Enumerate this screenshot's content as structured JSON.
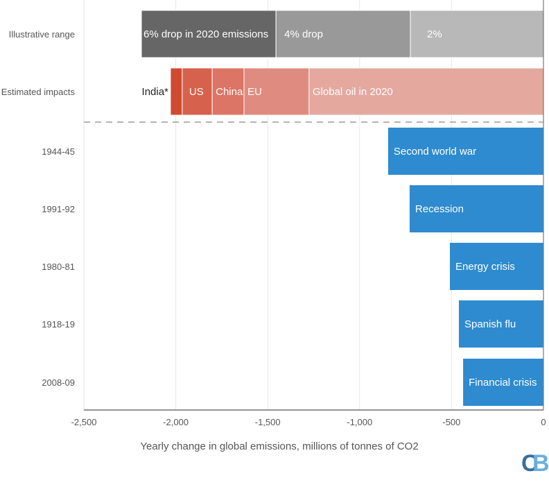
{
  "chart_data": {
    "type": "bar",
    "orientation": "horizontal",
    "title": "",
    "xlabel": "Yearly change in global emissions, millions of tonnes of CO2",
    "ylabel": "",
    "xlim": [
      -2500,
      0
    ],
    "xticks": [
      -2500,
      -2000,
      -1500,
      -1000,
      -500,
      0
    ],
    "xtick_labels": [
      "-2,500",
      "-2,000",
      "-1,500",
      "-1,000",
      "-500",
      "0"
    ],
    "grid": true,
    "rows": [
      {
        "category": "Illustrative range",
        "stacked": true,
        "segments": [
          {
            "label": "6% drop in 2020 emissions",
            "start": -2187,
            "end": -1455,
            "color": "#666666"
          },
          {
            "label": "4% drop",
            "start": -1455,
            "end": -724,
            "color": "#999999"
          },
          {
            "label": "2%",
            "start": -724,
            "end": 0,
            "color": "#b8b8b8"
          }
        ]
      },
      {
        "category": "Estimated impacts",
        "stacked": true,
        "segments": [
          {
            "label": "India*",
            "start": -2029,
            "end": -1965,
            "color": "#cf4a30",
            "label_outside": true
          },
          {
            "label": "US",
            "start": -1965,
            "end": -1802,
            "color": "#d6614c"
          },
          {
            "label": "China",
            "start": -1802,
            "end": -1629,
            "color": "#dc7565"
          },
          {
            "label": "EU",
            "start": -1629,
            "end": -1275,
            "color": "#e08b7f"
          },
          {
            "label": "Global oil in 2020",
            "start": -1275,
            "end": 0,
            "color": "#e4a89f"
          }
        ]
      },
      {
        "category": "1944-45",
        "segments": [
          {
            "label": "Second world war",
            "start": -845,
            "end": 0,
            "color": "#2e8bcf"
          }
        ]
      },
      {
        "category": "1991-92",
        "segments": [
          {
            "label": "Recession",
            "start": -728,
            "end": 0,
            "color": "#2e8bcf"
          }
        ]
      },
      {
        "category": "1980-81",
        "segments": [
          {
            "label": "Energy crisis",
            "start": -509,
            "end": 0,
            "color": "#2e8bcf"
          }
        ]
      },
      {
        "category": "1918-19",
        "segments": [
          {
            "label": "Spanish flu",
            "start": -460,
            "end": 0,
            "color": "#2e8bcf"
          }
        ]
      },
      {
        "category": "2008-09",
        "segments": [
          {
            "label": "Financial crisis",
            "start": -437,
            "end": 0,
            "color": "#2e8bcf"
          }
        ]
      }
    ],
    "separator_after_row": 1
  },
  "logo": {
    "c": "C",
    "b": "B"
  }
}
